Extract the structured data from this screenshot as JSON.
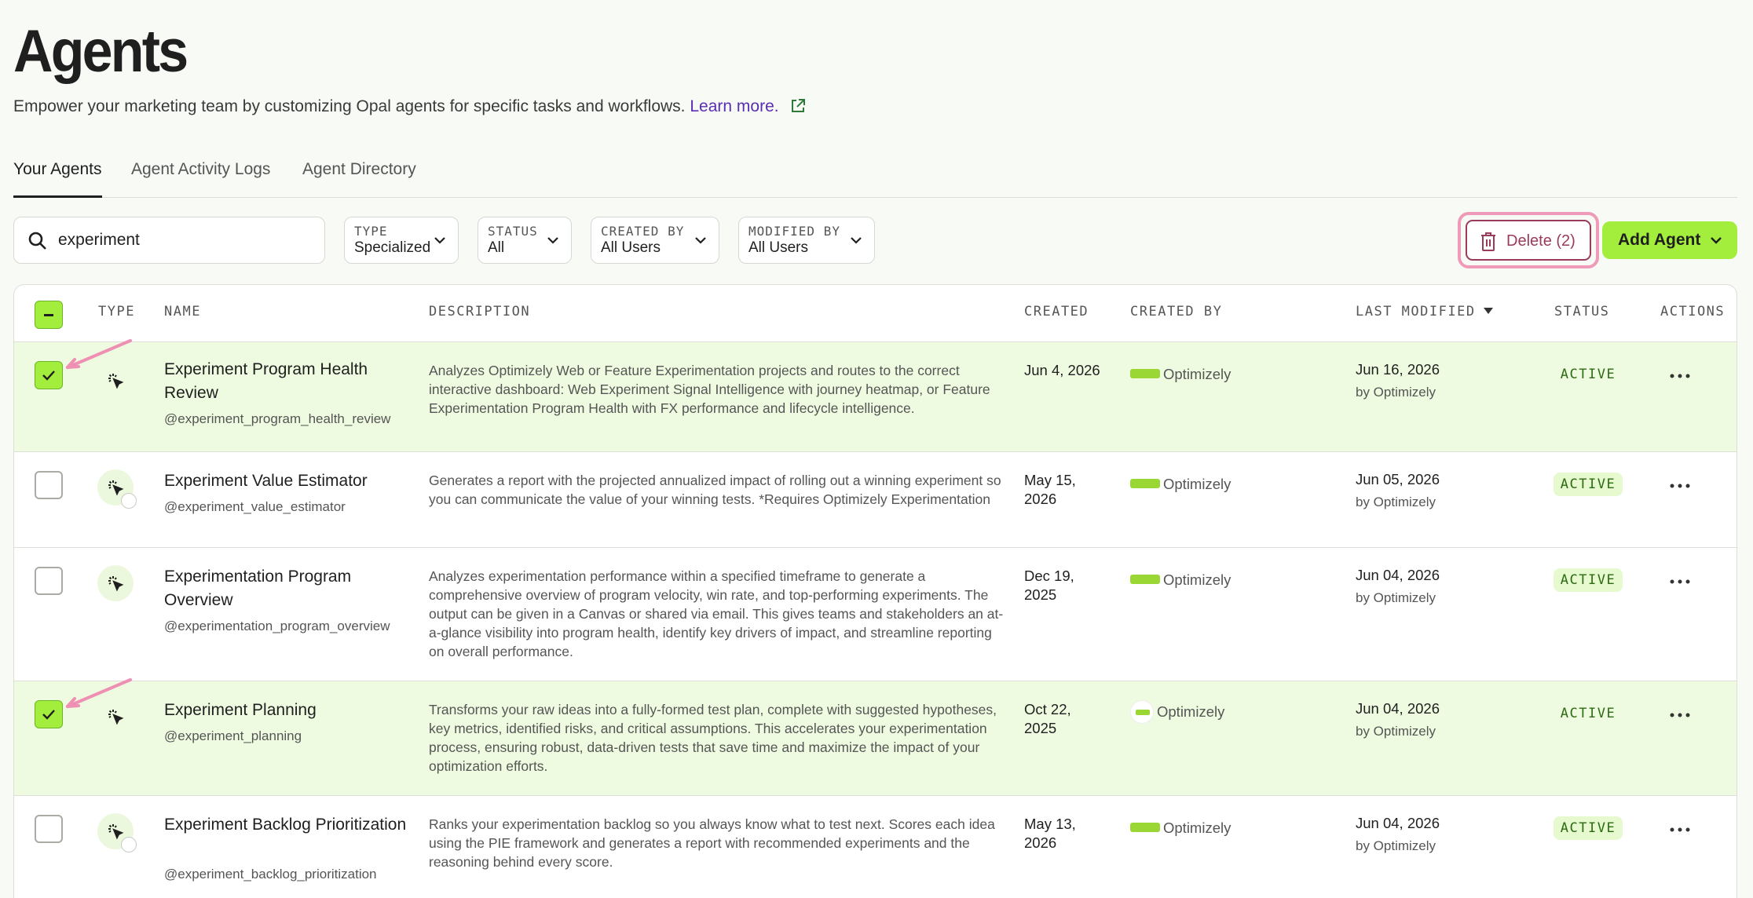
{
  "page": {
    "title": "Agents",
    "subtitle": "Empower your marketing team by customizing Opal agents for specific tasks and workflows.",
    "learn_more": "Learn more."
  },
  "tabs": [
    {
      "label": "Your Agents",
      "active": true
    },
    {
      "label": "Agent Activity Logs",
      "active": false
    },
    {
      "label": "Agent Directory",
      "active": false
    }
  ],
  "search": {
    "value": "experiment"
  },
  "filters": [
    {
      "label": "TYPE",
      "value": "Specialized"
    },
    {
      "label": "STATUS",
      "value": "All"
    },
    {
      "label": "CREATED BY",
      "value": "All Users"
    },
    {
      "label": "MODIFIED BY",
      "value": "All Users"
    }
  ],
  "actions": {
    "delete_label": "Delete (2)",
    "add_label": "Add Agent"
  },
  "columns": [
    "TYPE",
    "NAME",
    "DESCRIPTION",
    "CREATED",
    "CREATED BY",
    "LAST MODIFIED",
    "STATUS",
    "ACTIONS"
  ],
  "colors": {
    "accent": "#a3ee3c",
    "selected_row": "#eefbe0",
    "delete": "#9a3b5c",
    "highlight": "#ee9ab8",
    "link": "#5a2db3"
  },
  "rows": [
    {
      "selected": true,
      "name": "Experiment Program Health Review",
      "handle": "@experiment_program_health_review",
      "description": "Analyzes Optimizely Web or Feature Experimentation projects and routes to the correct interactive dashboard: Web Experiment Signal Intelligence with journey heatmap, or Feature Experimentation Program Health with FX performance and lifecycle intelligence.",
      "created": "Jun 4, 2026",
      "created_by": "Optimizely",
      "modified": "Jun 16, 2026",
      "modified_by": "by Optimizely",
      "status": "ACTIVE"
    },
    {
      "selected": false,
      "name": "Experiment Value Estimator",
      "handle": "@experiment_value_estimator",
      "description": "Generates a report with the projected annualized impact of rolling out a winning experiment so you can communicate the value of your winning tests. *Requires Optimizely Experimentation",
      "created": "May 15, 2026",
      "created_by": "Optimizely",
      "modified": "Jun 05, 2026",
      "modified_by": "by Optimizely",
      "status": "ACTIVE"
    },
    {
      "selected": false,
      "name": "Experimentation Program Overview",
      "handle": "@experimentation_program_overview",
      "description": "Analyzes experimentation performance within a specified timeframe to generate a comprehensive overview of program velocity, win rate, and top-performing experiments. The output can be given in a Canvas or shared via email. This gives teams and stakeholders an at-a-glance visibility into program health, identify key drivers of impact, and streamline reporting on overall performance.",
      "created": "Dec 19, 2025",
      "created_by": "Optimizely",
      "modified": "Jun 04, 2026",
      "modified_by": "by Optimizely",
      "status": "ACTIVE"
    },
    {
      "selected": true,
      "name": "Experiment Planning",
      "handle": "@experiment_planning",
      "description": "Transforms your raw ideas into a fully-formed test plan, complete with suggested hypotheses, key metrics, identified risks, and critical assumptions. This accelerates your experimentation process, ensuring robust, data-driven tests that save time and maximize the impact of your optimization efforts.",
      "created": "Oct 22, 2025",
      "created_by": "Optimizely",
      "modified": "Jun 04, 2026",
      "modified_by": "by Optimizely",
      "status": "ACTIVE"
    },
    {
      "selected": false,
      "name": "Experiment Backlog Prioritization",
      "handle": "@experiment_backlog_prioritization",
      "description": "Ranks your experimentation backlog so you always know what to test next. Scores each idea using the PIE framework and generates a report with recommended experiments and the reasoning behind every score.",
      "created": "May 13, 2026",
      "created_by": "Optimizely",
      "modified": "Jun 04, 2026",
      "modified_by": "by Optimizely",
      "status": "ACTIVE"
    }
  ]
}
